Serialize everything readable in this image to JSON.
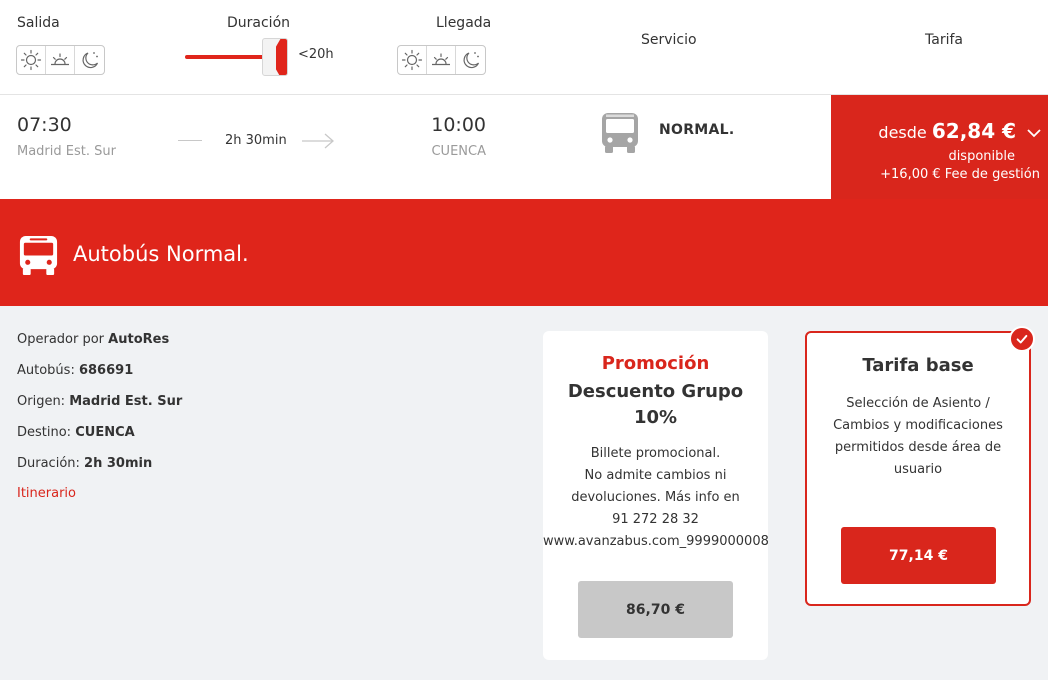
{
  "header": {
    "salida_label": "Salida",
    "duracion_label": "Duración",
    "llegada_label": "Llegada",
    "servicio_label": "Servicio",
    "tarifa_label": "Tarifa",
    "duration_max": "<20h",
    "duration_filter_fraction": 1.0,
    "time_of_day_icons": [
      "sun-icon",
      "sunset-icon",
      "moon-icon"
    ]
  },
  "trip": {
    "departure_time": "07:30",
    "departure_station": "Madrid Est. Sur",
    "duration": "2h 30min",
    "arrival_time": "10:00",
    "arrival_station": "CUENCA",
    "service": "NORMAL.",
    "fare_prefix": "desde",
    "fare_price": "62,84 €",
    "fare_status": "disponible",
    "fare_fee": "+16,00 € Fee de gestión"
  },
  "banner": {
    "title": "Autobús Normal."
  },
  "details": {
    "operator_label": "Operador por",
    "operator_value": "AutoRes",
    "bus_label": "Autobús:",
    "bus_value": "686691",
    "origin_label": "Origen:",
    "origin_value": "Madrid Est. Sur",
    "destination_label": "Destino:",
    "destination_value": "CUENCA",
    "duration_label": "Duración:",
    "duration_value": "2h 30min",
    "itinerary_link": "Itinerario"
  },
  "promo_card": {
    "kicker": "Promoción",
    "title_line1": "Descuento Grupo",
    "title_line2": "10%",
    "desc_lines": [
      "Billete promocional.",
      "No admite cambios ni",
      "devoluciones. Más info en",
      "91 272 28 32",
      "www.avanzabus.com_9999000008"
    ],
    "price": "86,70 €"
  },
  "base_card": {
    "title": "Tarifa base",
    "desc_lines": [
      "Selección de Asiento /",
      "Cambios y modificaciones",
      "permitidos desde área de",
      "usuario"
    ],
    "price": "77,14 €",
    "selected": true
  },
  "colors": {
    "brand_red": "#d9261c",
    "panel_bg": "#f0f2f4",
    "disabled_gray": "#c8c8c8"
  }
}
